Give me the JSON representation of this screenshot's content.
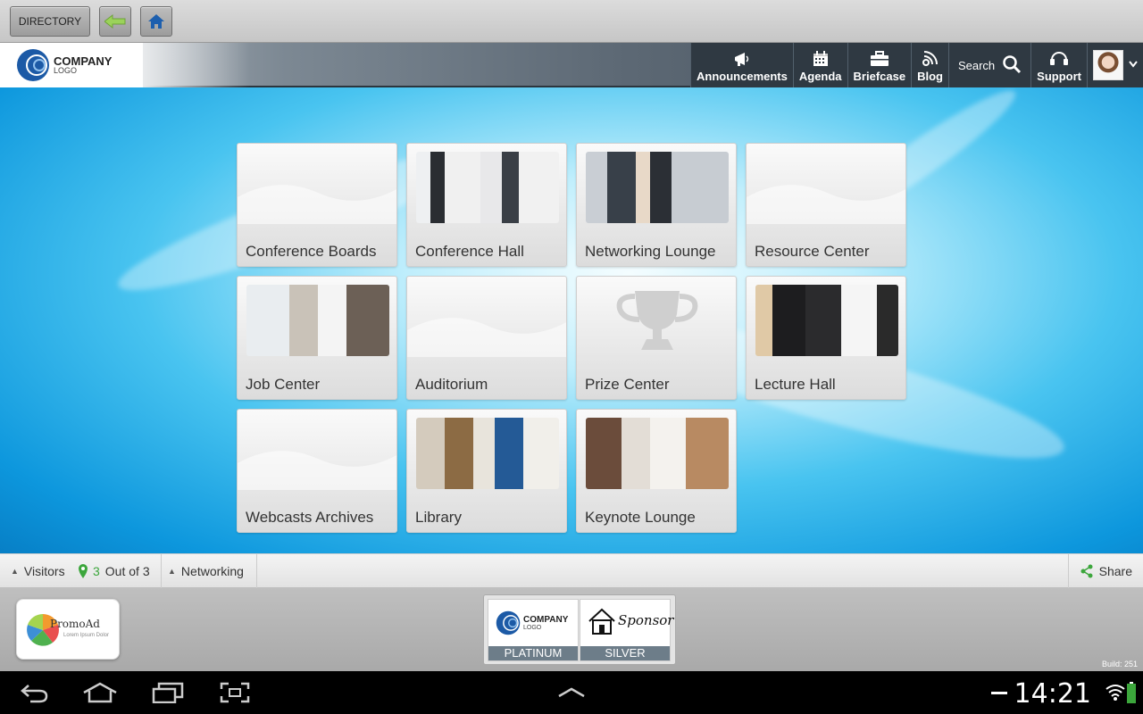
{
  "topbar": {
    "directory_label": "DIRECTORY"
  },
  "header": {
    "logo": {
      "company": "COMPANY",
      "sub": "LOGO"
    },
    "nav": [
      {
        "label": "Announcements"
      },
      {
        "label": "Agenda"
      },
      {
        "label": "Briefcase"
      },
      {
        "label": "Blog"
      },
      {
        "label": "Search"
      },
      {
        "label": "Support"
      }
    ]
  },
  "tiles": [
    {
      "label": "Conference Boards"
    },
    {
      "label": "Conference Hall"
    },
    {
      "label": "Networking Lounge"
    },
    {
      "label": "Resource Center"
    },
    {
      "label": "Job Center"
    },
    {
      "label": "Auditorium"
    },
    {
      "label": "Prize Center"
    },
    {
      "label": "Lecture Hall"
    },
    {
      "label": "Webcasts Archives"
    },
    {
      "label": "Library"
    },
    {
      "label": "Keynote Lounge"
    }
  ],
  "statusbar": {
    "visitors_label": "Visitors",
    "count_number": "3",
    "count_suffix": "Out of 3",
    "networking_label": "Networking",
    "share_label": "Share"
  },
  "sponsors": {
    "promo_title": "PromoAd",
    "promo_sub": "Lorem Ipsum Dolor",
    "items": [
      {
        "logo_company": "COMPANY",
        "logo_sub": "LOGO",
        "tier": "PLATINUM"
      },
      {
        "logo_text": "Sponsor",
        "tier": "SILVER"
      }
    ],
    "build": "Build: 251"
  },
  "system": {
    "clock": "14:21"
  },
  "colors": {
    "accent_green": "#3ca63c",
    "header_dark": "#2f3942",
    "tier_bar": "#6d7d89"
  }
}
